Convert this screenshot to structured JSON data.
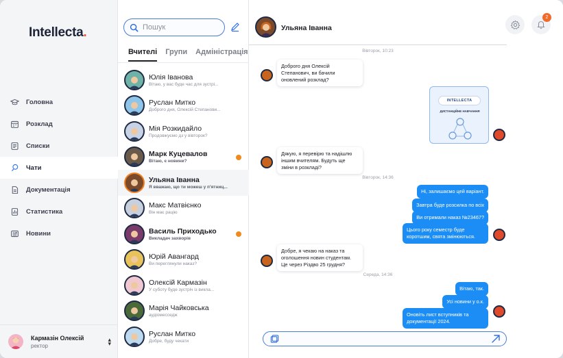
{
  "brand": {
    "name": "Intellecta",
    "dot": ".",
    "accent": "#f04a2a"
  },
  "nav": [
    {
      "label": "Головна",
      "icon": "graduation-cap-icon"
    },
    {
      "label": "Розклад",
      "icon": "calendar-icon"
    },
    {
      "label": "Списки",
      "icon": "list-icon"
    },
    {
      "label": "Чати",
      "icon": "chat-icon",
      "active": true
    },
    {
      "label": "Документація",
      "icon": "document-icon"
    },
    {
      "label": "Статистика",
      "icon": "statistics-icon"
    },
    {
      "label": "Новини",
      "icon": "news-icon"
    }
  ],
  "user": {
    "name": "Кармазін Олексій",
    "role": "ректор"
  },
  "search": {
    "placeholder": "Пошук"
  },
  "tabs": [
    "Вчителі",
    "Групи",
    "Адміністрація"
  ],
  "contacts": [
    {
      "name": "Юлія Іванова",
      "preview": "Вітаю, у вас буде час для зустрі...",
      "bg": "#6fb3a8"
    },
    {
      "name": "Руслан Митко",
      "preview": "Доброго дня, Олексій Степанови...",
      "bg": "#8fc5e8"
    },
    {
      "name": "Мія Розкидайло",
      "preview": "Продовжуємо дз у вівторок?",
      "bg": "#c9d3e6"
    },
    {
      "name": "Марк Куцевалов",
      "preview": "Вітаю, є новини?",
      "bg": "#6a5a4a",
      "unread": true
    },
    {
      "name": "Ульяна Іванна",
      "preview": "Я вважаю, що ти можеш у п'ятниц...",
      "bg": "#7a4a2a",
      "active": true
    },
    {
      "name": "Макс Матвієнко",
      "preview": "Він має рацію",
      "bg": "#c8d0de"
    },
    {
      "name": "Василь Приходько",
      "preview": "Викладач захворів",
      "bg": "#7a3a6a",
      "unread": true
    },
    {
      "name": "Юрій Авангард",
      "preview": "Ви переглянули наказ?",
      "bg": "#e8c25a"
    },
    {
      "name": "Олексій Кармазін",
      "preview": "У суботу буде зустріч із викла...",
      "bg": "#f0c8d0"
    },
    {
      "name": "Марія Чайковська",
      "preview": "аудіомесседж",
      "bg": "#4a6a3a"
    },
    {
      "name": "Руслан Митко",
      "preview": "Добре, буду чекати",
      "bg": "#bcd9f0"
    }
  ],
  "chat": {
    "title": "Ульяна Іванна",
    "badge": "2",
    "stamps": [
      "Вівторок, 10:23",
      "Вівторок, 14:36",
      "Середа, 14:36"
    ],
    "card": {
      "pill": "INTELLECTA",
      "caption": "ДИСТАНЦІЙНЕ НАВЧАННЯ"
    },
    "messages": [
      {
        "dir": "in",
        "text": "Доброго дня Олексій Степанович, ви бачили оновлений розклад?"
      },
      {
        "dir": "in",
        "text": "Дякую, я перевірю та надішлю іншим вчителям. Будуть ще зміни в розкладі?"
      },
      {
        "dir": "out",
        "text": "Ні, залишаємо цей варіант."
      },
      {
        "dir": "out",
        "text": "Завтра буде розсилка по всіх"
      },
      {
        "dir": "out",
        "text": "Ви отримали наказ №23467?"
      },
      {
        "dir": "out",
        "text": "Цього року семестр буде коротшим, свята змінюються."
      },
      {
        "dir": "in",
        "text": "Добре, я чекаю на наказ та оголошення новин студентам. Це через Різдво 25 грудня?"
      },
      {
        "dir": "out",
        "text": "Вітаю, так."
      },
      {
        "dir": "out",
        "text": "Усі новини у о.к."
      },
      {
        "dir": "out",
        "text": "Оновіть лист вступників та документації 2024."
      }
    ]
  },
  "colors": {
    "accent_blue": "#1c8df5",
    "unread": "#f08a1c",
    "active_ring": "#f0811e"
  }
}
